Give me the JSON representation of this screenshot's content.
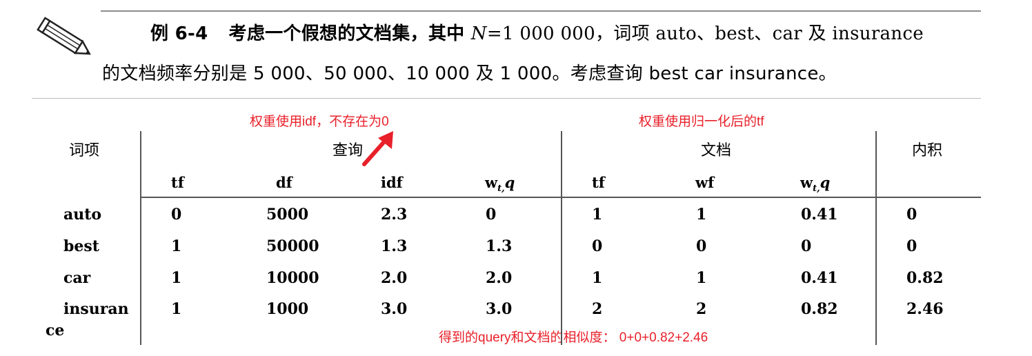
{
  "example": {
    "label": "例 6-4",
    "line1_a": "考虑一个假想的文档集，其中 ",
    "n_var": "N",
    "line1_b": "=1 000 000，词项 auto、best、car 及 insurance",
    "line2": "的文档频率分别是 5 000、50 000、10 000 及 1 000。考虑查询 best car insurance。"
  },
  "icon": "pencil-icon",
  "annotations": {
    "query_weight": "权重使用idf，不存在为0",
    "doc_weight": "权重使用归一化后的tf",
    "similarity": "得到的query和文档的相似度：  0+0+0.82+2.46",
    "color": "#e8202a"
  },
  "table": {
    "group_headers": {
      "term": "词项",
      "query": "查询",
      "document": "文档",
      "product": "内积"
    },
    "sub_headers": {
      "q_tf": "tf",
      "q_df": "df",
      "q_idf": "idf",
      "q_w": "w",
      "q_w_sub": "t,",
      "q_w_q": "q",
      "d_tf": "tf",
      "d_wf": "wf",
      "d_w": "w",
      "d_w_sub": "t,",
      "d_w_q": "q"
    },
    "rows": [
      {
        "term": "auto",
        "term_cont": "",
        "q_tf": "0",
        "q_df": "5000",
        "q_idf": "2.3",
        "q_w": "0",
        "d_tf": "1",
        "d_wf": "1",
        "d_w": "0.41",
        "product": "0"
      },
      {
        "term": "best",
        "term_cont": "",
        "q_tf": "1",
        "q_df": "50000",
        "q_idf": "1.3",
        "q_w": "1.3",
        "d_tf": "0",
        "d_wf": "0",
        "d_w": "0",
        "product": "0"
      },
      {
        "term": "car",
        "term_cont": "",
        "q_tf": "1",
        "q_df": "10000",
        "q_idf": "2.0",
        "q_w": "2.0",
        "d_tf": "1",
        "d_wf": "1",
        "d_w": "0.41",
        "product": "0.82"
      },
      {
        "term": "insuran",
        "term_cont": "ce",
        "q_tf": "1",
        "q_df": "1000",
        "q_idf": "3.0",
        "q_w": "3.0",
        "d_tf": "2",
        "d_wf": "2",
        "d_w": "0.82",
        "product": "2.46"
      }
    ]
  }
}
